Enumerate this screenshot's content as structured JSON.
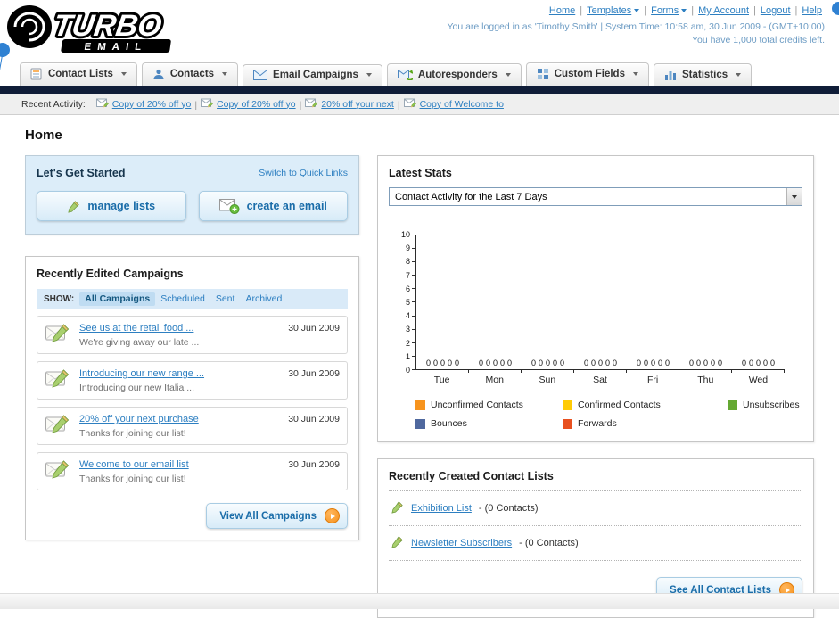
{
  "page": {
    "title": "Home"
  },
  "header": {
    "logo_title": "TURBO",
    "logo_subtitle": "EMAIL",
    "links": [
      {
        "label": "Home",
        "dropdown": false
      },
      {
        "label": "Templates",
        "dropdown": true
      },
      {
        "label": "Forms",
        "dropdown": true
      },
      {
        "label": "My Account",
        "dropdown": false
      },
      {
        "label": "Logout",
        "dropdown": false
      },
      {
        "label": "Help",
        "dropdown": false
      }
    ],
    "login_info": "You are logged in as 'Timothy Smith' | System Time: 10:58 am, 30 Jun 2009 - (GMT+10:00)",
    "credits_info": "You have 1,000 total credits left."
  },
  "nav": {
    "tabs": [
      {
        "label": "Contact Lists",
        "icon": "contact-lists-icon"
      },
      {
        "label": "Contacts",
        "icon": "contacts-icon"
      },
      {
        "label": "Email Campaigns",
        "icon": "email-campaigns-icon"
      },
      {
        "label": "Autoresponders",
        "icon": "autoresponders-icon"
      },
      {
        "label": "Custom Fields",
        "icon": "custom-fields-icon"
      },
      {
        "label": "Statistics",
        "icon": "statistics-icon"
      }
    ]
  },
  "recent_activity": {
    "label": "Recent Activity:",
    "items": [
      "Copy of 20% off yo",
      "Copy of 20% off yo",
      "20% off your next",
      "Copy of Welcome to"
    ]
  },
  "get_started": {
    "title": "Let's Get Started",
    "switch_link": "Switch to Quick Links",
    "manage_lists_label": "manage lists",
    "create_email_label": "create an email"
  },
  "campaigns": {
    "title": "Recently Edited Campaigns",
    "show_label": "SHOW:",
    "filters": [
      "All Campaigns",
      "Scheduled",
      "Sent",
      "Archived"
    ],
    "active_filter": "All Campaigns",
    "items": [
      {
        "title": "See us at the retail food ...",
        "subtitle": "We're giving away our late ...",
        "date": "30 Jun 2009"
      },
      {
        "title": "Introducing our new range ...",
        "subtitle": "Introducing our new Italia ...",
        "date": "30 Jun 2009"
      },
      {
        "title": "20% off your next purchase",
        "subtitle": "Thanks for joining our list!",
        "date": "30 Jun 2009"
      },
      {
        "title": "Welcome to our email list",
        "subtitle": "Thanks for joining our list!",
        "date": "30 Jun 2009"
      }
    ],
    "view_all_label": "View All Campaigns"
  },
  "stats": {
    "title": "Latest Stats",
    "dropdown_value": "Contact Activity for the Last 7 Days",
    "chart_data": {
      "type": "bar",
      "title": "",
      "xlabel": "",
      "ylabel": "",
      "categories": [
        "Tue",
        "Mon",
        "Sun",
        "Sat",
        "Fri",
        "Thu",
        "Wed"
      ],
      "series": [
        {
          "name": "Unconfirmed Contacts",
          "color": "#f7941e",
          "values": [
            0,
            0,
            0,
            0,
            0,
            0,
            0
          ]
        },
        {
          "name": "Confirmed Contacts",
          "color": "#ffcb05",
          "values": [
            0,
            0,
            0,
            0,
            0,
            0,
            0
          ]
        },
        {
          "name": "Unsubscribes",
          "color": "#64a832",
          "values": [
            0,
            0,
            0,
            0,
            0,
            0,
            0
          ]
        },
        {
          "name": "Bounces",
          "color": "#4f689e",
          "values": [
            0,
            0,
            0,
            0,
            0,
            0,
            0
          ]
        },
        {
          "name": "Forwards",
          "color": "#e8501f",
          "values": [
            0,
            0,
            0,
            0,
            0,
            0,
            0
          ]
        }
      ],
      "ylim": [
        0,
        10
      ],
      "yticks": [
        0,
        1,
        2,
        3,
        4,
        5,
        6,
        7,
        8,
        9,
        10
      ],
      "grid": false,
      "legend_position": "bottom"
    }
  },
  "contact_lists": {
    "title": "Recently Created Contact Lists",
    "items": [
      {
        "name": "Exhibition List",
        "detail": "- (0 Contacts)"
      },
      {
        "name": "Newsletter Subscribers",
        "detail": "- (0 Contacts)"
      }
    ],
    "see_all_label": "See All Contact Lists"
  }
}
